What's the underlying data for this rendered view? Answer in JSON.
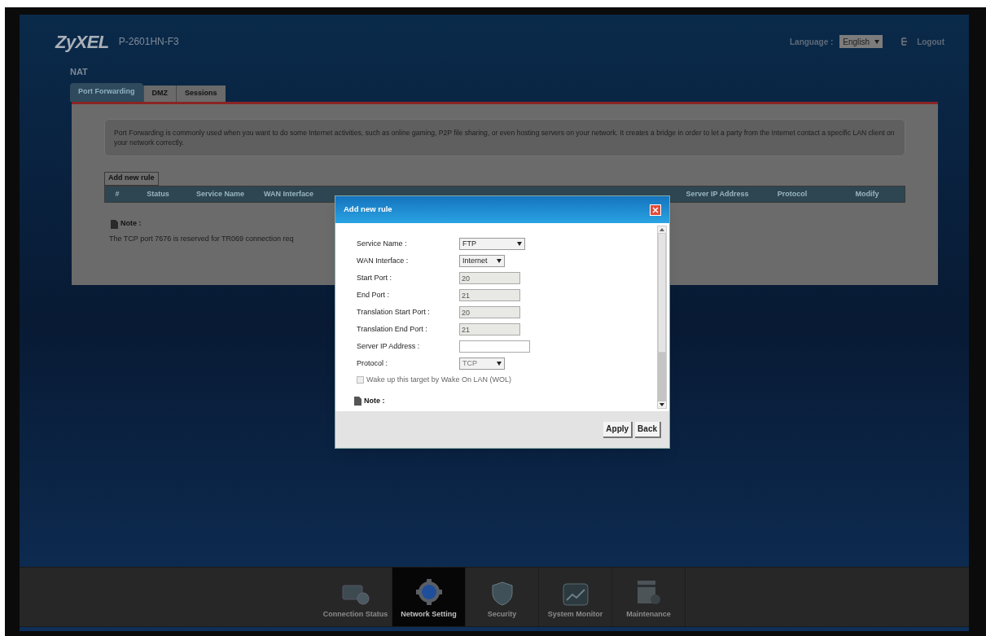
{
  "header": {
    "logo": "ZyXEL",
    "model": "P-2601HN-F3",
    "language_label": "Language :",
    "language": "English",
    "logout": "Logout"
  },
  "section_title": "NAT",
  "tabs": [
    {
      "label": "Port Forwarding",
      "selected": true
    },
    {
      "label": "DMZ",
      "selected": false
    },
    {
      "label": "Sessions",
      "selected": false
    }
  ],
  "description": "Port Forwarding is commonly used when you want to do some Internet activities, such as online gaming, P2P file sharing, or even hosting servers on your network. It creates a bridge in order to let a party from the Internet contact a specific LAN client on your network correctly.",
  "add_button": "Add new rule",
  "table": {
    "columns_left": [
      "#",
      "Status",
      "Service Name",
      "WAN Interface"
    ],
    "columns_right": [
      "Server IP Address",
      "Protocol",
      "Modify"
    ]
  },
  "note": {
    "title": "Note :",
    "text": "The TCP port 7676 is reserved for TR069 connection req"
  },
  "dialog": {
    "title": "Add new rule",
    "fields": [
      {
        "label": "Service Name :",
        "kind": "select",
        "value": "FTP",
        "disabled": false
      },
      {
        "label": "WAN Interface :",
        "kind": "select",
        "value": "Internet",
        "disabled": false
      },
      {
        "label": "Start Port :",
        "kind": "input",
        "value": "20",
        "disabled": true
      },
      {
        "label": "End Port :",
        "kind": "input",
        "value": "21",
        "disabled": true
      },
      {
        "label": "Translation Start Port :",
        "kind": "input",
        "value": "20",
        "disabled": true
      },
      {
        "label": "Translation End Port :",
        "kind": "input",
        "value": "21",
        "disabled": true
      },
      {
        "label": "Server IP Address :",
        "kind": "input",
        "disabled": false
      },
      {
        "label": "Protocol :",
        "kind": "select",
        "value": "TCP",
        "disabled": true
      }
    ],
    "wol": {
      "label": "Wake up this target by Wake On LAN (WOL)",
      "checked": false,
      "disabled": true
    },
    "note_title": "Note :",
    "buttons": [
      "Apply",
      "Back"
    ]
  },
  "bottom_nav": [
    {
      "label": "Connection Status",
      "selected": false
    },
    {
      "label": "Network Setting",
      "selected": true
    },
    {
      "label": "Security",
      "selected": false
    },
    {
      "label": "System Monitor",
      "selected": false
    },
    {
      "label": "Maintenance",
      "selected": false
    }
  ]
}
